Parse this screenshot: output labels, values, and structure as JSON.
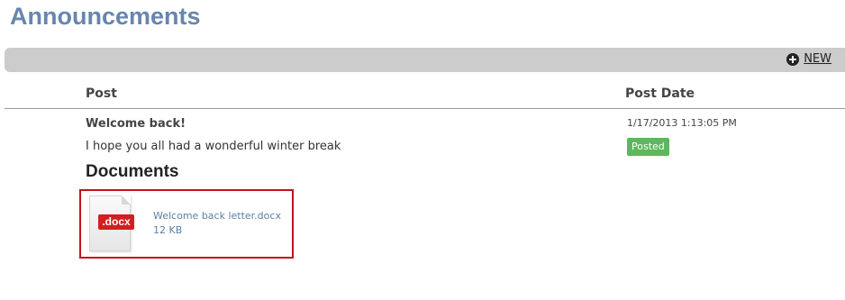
{
  "page": {
    "title": "Announcements"
  },
  "toolbar": {
    "new_icon": "plus-circle-icon",
    "new_label": "NEW"
  },
  "table": {
    "columns": [
      "Post",
      "Post Date"
    ]
  },
  "posts": [
    {
      "title": "Welcome back!",
      "body": "I hope you all had a wonderful winter break",
      "date": "1/17/2013 1:13:05 PM",
      "status": "Posted",
      "documents_heading": "Documents",
      "documents": [
        {
          "icon": "docx-file-icon",
          "badge": ".docx",
          "name": "Welcome back letter.docx",
          "size": "12 KB"
        }
      ]
    }
  ],
  "colors": {
    "title": "#6786ad",
    "toolbar": "#cccccc",
    "status_posted": "#5cb85c",
    "doc_badge": "#d11f1f",
    "highlight_border": "#c0121c",
    "link": "#5b7fa8"
  }
}
